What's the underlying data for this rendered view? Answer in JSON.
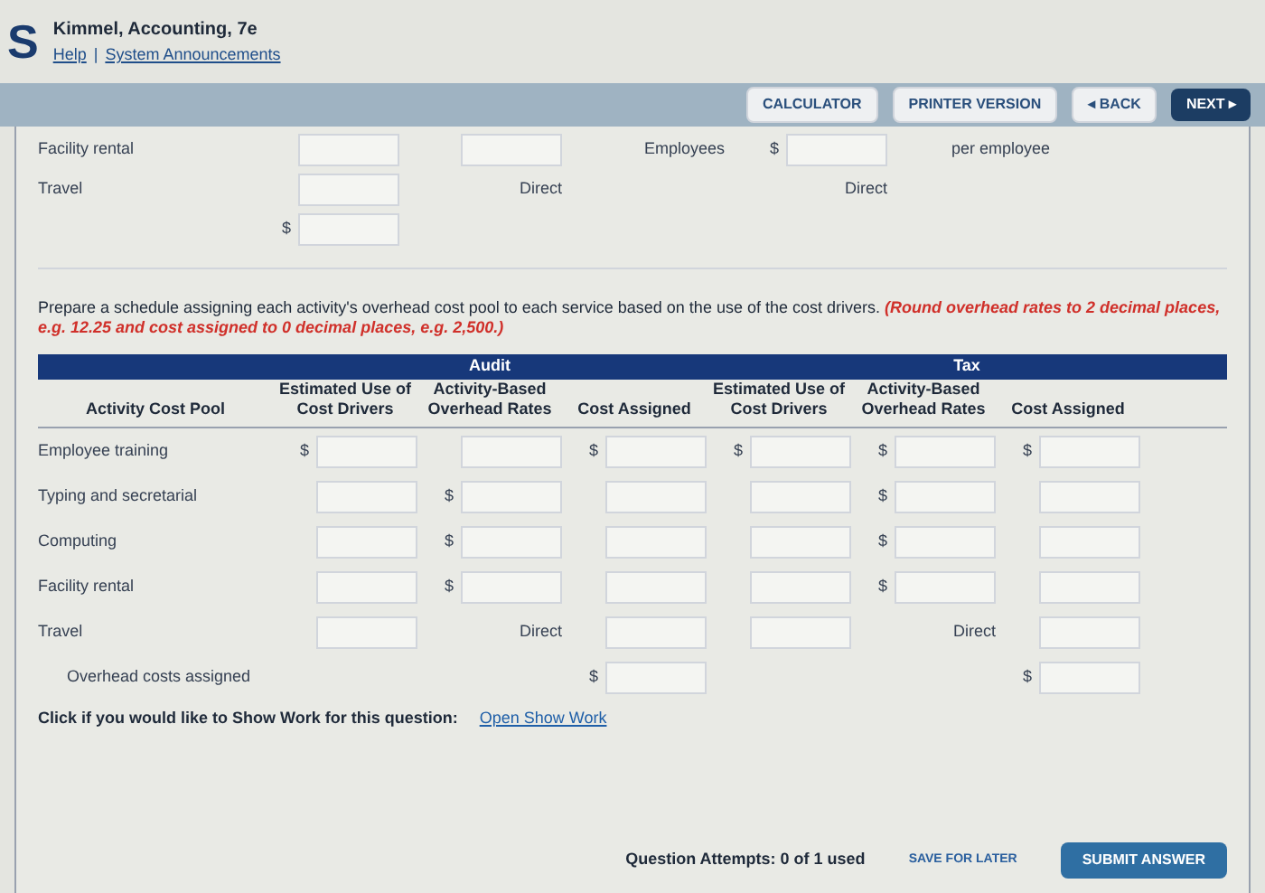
{
  "header": {
    "logo": "S",
    "title": "Kimmel, Accounting, 7e",
    "links": [
      "Help",
      "System Announcements"
    ],
    "separator": "|"
  },
  "nav_buttons": [
    {
      "label": "CALCULATOR",
      "kind": "plain"
    },
    {
      "label": "PRINTER VERSION",
      "kind": "plain"
    },
    {
      "label": "◂ BACK",
      "kind": "plain"
    },
    {
      "label": "NEXT ▸",
      "kind": "primary"
    }
  ],
  "upper_rows": [
    [
      {
        "kind": "text",
        "text": "Facility rental"
      },
      {
        "kind": "input"
      },
      {
        "kind": "input"
      },
      {
        "kind": "text",
        "text": "Employees"
      },
      {
        "kind": "input",
        "prefix": "$"
      },
      {
        "kind": "text",
        "text": "per employee"
      }
    ],
    [
      {
        "kind": "text",
        "text": "Travel"
      },
      {
        "kind": "input"
      },
      {
        "kind": "text",
        "text": "Direct"
      },
      {
        "kind": "blank"
      },
      {
        "kind": "text",
        "text": "Direct"
      },
      {
        "kind": "blank"
      }
    ],
    [
      {
        "kind": "blank"
      },
      {
        "kind": "input",
        "prefix": "$"
      },
      {
        "kind": "blank"
      },
      {
        "kind": "blank"
      },
      {
        "kind": "blank"
      },
      {
        "kind": "blank"
      }
    ]
  ],
  "instruction": "Prepare a schedule assigning each activity's overhead cost pool to each service based on the use of the cost drivers.",
  "instruction_note": "(Round overhead rates to 2 decimal places, e.g. 12.25 and cost assigned to 0 decimal places, e.g. 2,500.)",
  "table": {
    "groups": [
      "Audit",
      "Tax"
    ],
    "columns": [
      "Activity Cost Pool",
      "Estimated Use of Cost Drivers",
      "Activity-Based Overhead Rates",
      "Cost Assigned",
      "Estimated Use of Cost Drivers",
      "Activity-Based Overhead Rates",
      "Cost Assigned"
    ],
    "rows": [
      {
        "cells": [
          {
            "kind": "label",
            "text": "Employee training"
          },
          {
            "kind": "input",
            "prefix": "$"
          },
          {
            "kind": "input"
          },
          {
            "kind": "input",
            "prefix": "$"
          },
          {
            "kind": "input",
            "prefix": "$"
          },
          {
            "kind": "input",
            "prefix": "$"
          },
          {
            "kind": "input",
            "prefix": "$"
          }
        ]
      },
      {
        "cells": [
          {
            "kind": "label",
            "text": "Typing and secretarial"
          },
          {
            "kind": "input"
          },
          {
            "kind": "input",
            "prefix": "$"
          },
          {
            "kind": "input"
          },
          {
            "kind": "input"
          },
          {
            "kind": "input",
            "prefix": "$"
          },
          {
            "kind": "input"
          }
        ]
      },
      {
        "cells": [
          {
            "kind": "label",
            "text": "Computing"
          },
          {
            "kind": "input"
          },
          {
            "kind": "input",
            "prefix": "$"
          },
          {
            "kind": "input"
          },
          {
            "kind": "input"
          },
          {
            "kind": "input",
            "prefix": "$"
          },
          {
            "kind": "input"
          }
        ]
      },
      {
        "cells": [
          {
            "kind": "label",
            "text": "Facility rental"
          },
          {
            "kind": "input"
          },
          {
            "kind": "input",
            "prefix": "$"
          },
          {
            "kind": "input"
          },
          {
            "kind": "input"
          },
          {
            "kind": "input",
            "prefix": "$"
          },
          {
            "kind": "input"
          }
        ]
      },
      {
        "cells": [
          {
            "kind": "label",
            "text": "Travel"
          },
          {
            "kind": "input"
          },
          {
            "kind": "text",
            "text": "Direct"
          },
          {
            "kind": "input"
          },
          {
            "kind": "input"
          },
          {
            "kind": "text",
            "text": "Direct"
          },
          {
            "kind": "input"
          }
        ]
      }
    ],
    "total": {
      "cells": [
        {
          "kind": "label",
          "text": "Overhead costs assigned"
        },
        {
          "kind": "blank"
        },
        {
          "kind": "blank"
        },
        {
          "kind": "input",
          "prefix": "$"
        },
        {
          "kind": "blank"
        },
        {
          "kind": "blank"
        },
        {
          "kind": "input",
          "prefix": "$"
        }
      ]
    }
  },
  "show_work": {
    "prompt": "Click if you would like to Show Work for this question:",
    "link": "Open Show Work"
  },
  "footer": {
    "attempts": "Question Attempts: 0 of 1 used",
    "save": "SAVE FOR LATER",
    "submit": "SUBMIT ANSWER"
  }
}
